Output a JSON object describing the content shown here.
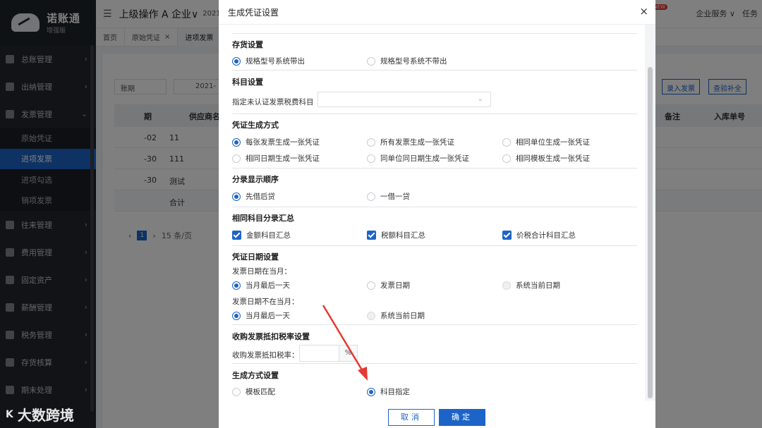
{
  "app": {
    "name": "诺账通",
    "edition": "增强版"
  },
  "sidebar": {
    "items": [
      {
        "label": "总账管理"
      },
      {
        "label": "出纳管理"
      },
      {
        "label": "发票管理"
      },
      {
        "label": "往来管理"
      },
      {
        "label": "费用管理"
      },
      {
        "label": "固定资产"
      },
      {
        "label": "薪酬管理"
      },
      {
        "label": "税务管理"
      },
      {
        "label": "存货核算"
      },
      {
        "label": "期末处理"
      }
    ],
    "submenu": [
      {
        "label": "原始凭证"
      },
      {
        "label": "进项发票"
      },
      {
        "label": "进项勾选"
      },
      {
        "label": "销项发票"
      }
    ]
  },
  "topbar": {
    "company": "上级操作 A 企业∨",
    "period": "2021",
    "new_badge": "NEW",
    "enterprise_service": "企业服务 ∨",
    "tasks": "任务"
  },
  "tabs": [
    {
      "label": "首页"
    },
    {
      "label": "原始凭证"
    },
    {
      "label": "进项发票"
    }
  ],
  "background": {
    "filter_label": "账期",
    "date_value": "2021-",
    "btn_enter_invoice": "录入发票",
    "btn_check_fill": "查验补全",
    "columns": [
      "期",
      "供应商名",
      "备注",
      "入库单号"
    ],
    "rows": [
      {
        "date": "-02",
        "supplier": "11"
      },
      {
        "date": "-30",
        "supplier": "111"
      },
      {
        "date": "-30",
        "supplier": "测试"
      },
      {
        "date": "",
        "supplier": "合计"
      }
    ],
    "pager_page": "1",
    "pager_size": "15 条/页"
  },
  "modal": {
    "title": "生成凭证设置",
    "close_icon": "×",
    "inventory": {
      "title": "存货设置",
      "options": [
        "规格型号系统带出",
        "规格型号系统不带出"
      ],
      "selected": 0
    },
    "account": {
      "title": "科目设置",
      "field_label": "指定未认证发票税费科目",
      "field_value": ""
    },
    "voucher_gen": {
      "title": "凭证生成方式",
      "options": [
        "每张发票生成一张凭证",
        "所有发票生成一张凭证",
        "相同单位生成一张凭证",
        "相同日期生成一张凭证",
        "同单位同日期生成一张凭证",
        "相同模板生成一张凭证"
      ],
      "selected": 0
    },
    "entry_order": {
      "title": "分录显示顺序",
      "options": [
        "先借后贷",
        "一借一贷"
      ],
      "selected": 0
    },
    "same_account": {
      "title": "相同科目分录汇总",
      "options": [
        "金额科目汇总",
        "税额科目汇总",
        "价税合计科目汇总"
      ]
    },
    "date_setting": {
      "title": "凭证日期设置",
      "in_month_label": "发票日期在当月：",
      "in_month_options": [
        "当月最后一天",
        "发票日期",
        "系统当前日期"
      ],
      "not_in_month_label": "发票日期不在当月：",
      "not_in_month_options": [
        "当月最后一天",
        "系统当前日期"
      ]
    },
    "deduct_rate": {
      "title": "收购发票抵扣税率设置",
      "field_label": "收购发票抵扣税率：",
      "value": "",
      "unit": "%"
    },
    "gen_method": {
      "title": "生成方式设置",
      "options": [
        "模板匹配",
        "科目指定"
      ],
      "selected": 1
    },
    "cancel_label": "取消",
    "ok_label": "确定"
  },
  "watermark": {
    "logo": "K",
    "text": "大数跨境"
  },
  "colors": {
    "primary": "#1d64c8",
    "sidebar": "#22272e",
    "annotation_arrow": "#e53935"
  }
}
